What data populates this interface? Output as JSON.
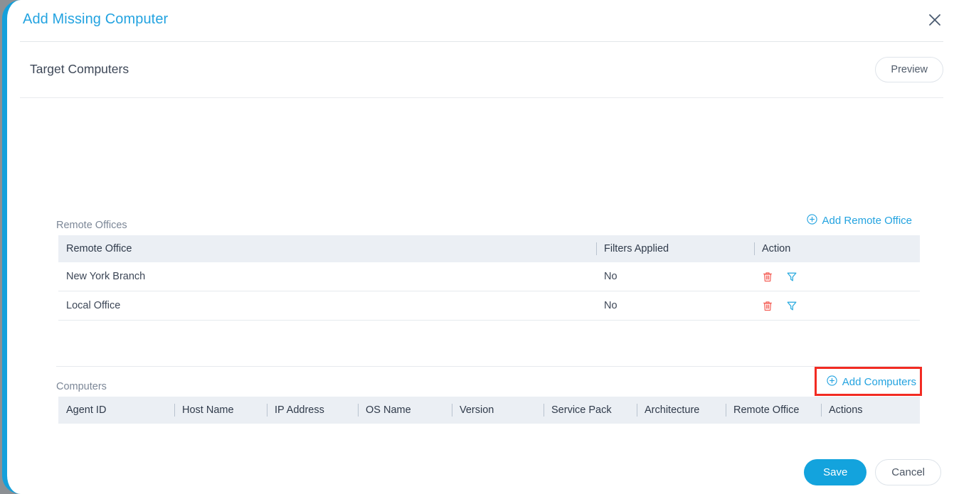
{
  "dialog": {
    "title": "Add Missing Computer",
    "close_icon": "close-icon"
  },
  "section": {
    "title": "Target Computers",
    "preview_label": "Preview"
  },
  "remote_offices": {
    "label": "Remote Offices",
    "add_link_label": "Add Remote Office",
    "add_link_icon": "plus-circle-icon",
    "columns": [
      "Remote Office",
      "Filters Applied",
      "Action"
    ],
    "rows": [
      {
        "remote_office": "New York Branch",
        "filters_applied": "No",
        "actions": [
          "delete-icon",
          "filter-icon"
        ]
      },
      {
        "remote_office": "Local Office",
        "filters_applied": "No",
        "actions": [
          "delete-icon",
          "filter-icon"
        ]
      }
    ]
  },
  "computers": {
    "label": "Computers",
    "add_link_label": "Add Computers",
    "add_link_icon": "plus-circle-icon",
    "columns": [
      "Agent ID",
      "Host Name",
      "IP Address",
      "OS Name",
      "Version",
      "Service Pack",
      "Architecture",
      "Remote Office",
      "Actions"
    ],
    "rows": []
  },
  "footer": {
    "save_label": "Save",
    "cancel_label": "Cancel"
  },
  "colors": {
    "accent": "#23a3e0",
    "save_button": "#13a3dd",
    "delete_icon": "#f4625a",
    "filter_icon": "#33aee0",
    "highlight_box": "#f22b22",
    "table_header_bg": "#ebeff4",
    "left_edge_bar": "#14a0db"
  }
}
